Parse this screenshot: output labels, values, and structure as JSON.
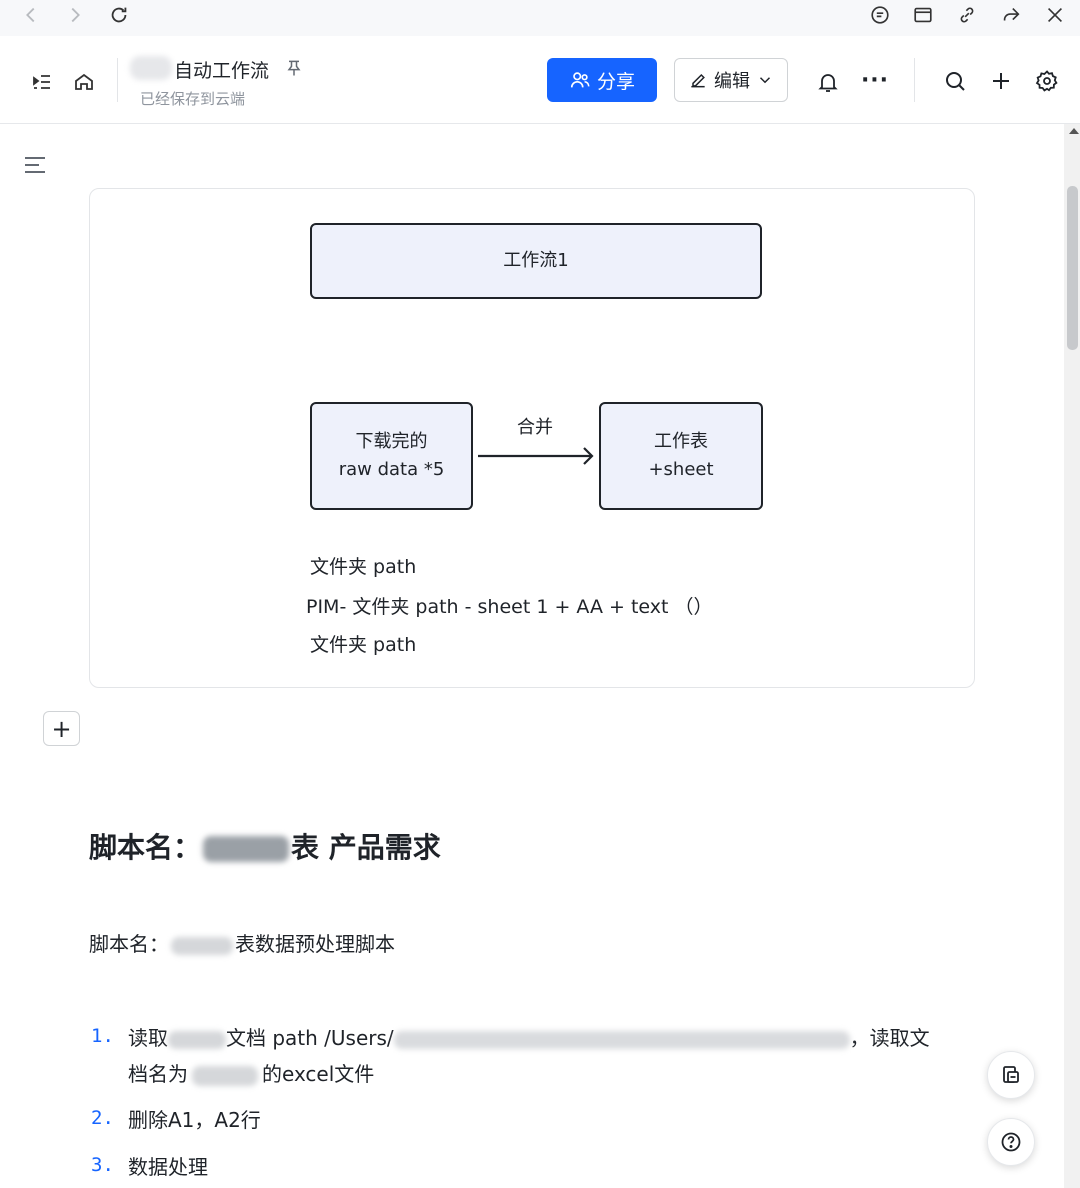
{
  "browser": {
    "nav_icons": [
      "back-icon",
      "forward-icon",
      "reload-icon"
    ],
    "window_icons": [
      "comment-icon",
      "window-icon",
      "link-icon",
      "share-arrow-icon",
      "close-icon"
    ]
  },
  "header": {
    "title": "自动工作流",
    "save_status": "已经保存到云端",
    "pin_glyph": "⚲",
    "share_label": "分享",
    "edit_label": "编辑",
    "more_glyph": "···"
  },
  "diagram": {
    "node_top": "工作流1",
    "node_left_line1": "下载完的",
    "node_left_line2": "raw data *5",
    "edge_label": "合并",
    "node_right_line1": "工作表",
    "node_right_line2": "+sheet",
    "text1": "文件夹 path",
    "text2": "PIM- 文件夹 path  - sheet 1  + AA + text （）",
    "text3": "文件夹 path"
  },
  "doc": {
    "add_glyph": "+",
    "heading_prefix": "脚本名：",
    "heading_suffix": "表 产品需求",
    "para_prefix": "脚本名：",
    "para_suffix": "表数据预处理脚本",
    "list": [
      {
        "num": "1.",
        "line1_a": "读取",
        "line1_b": "文档 path /Users/",
        "line1_c": "，读取文",
        "line2_a": "档名为",
        "line2_b": "的excel文件"
      },
      {
        "num": "2.",
        "text": "删除A1，A2行"
      },
      {
        "num": "3.",
        "text": "数据处理"
      }
    ]
  },
  "colors": {
    "accent": "#1664ff",
    "node_fill": "#eef1fb",
    "node_border": "#1f2329"
  }
}
